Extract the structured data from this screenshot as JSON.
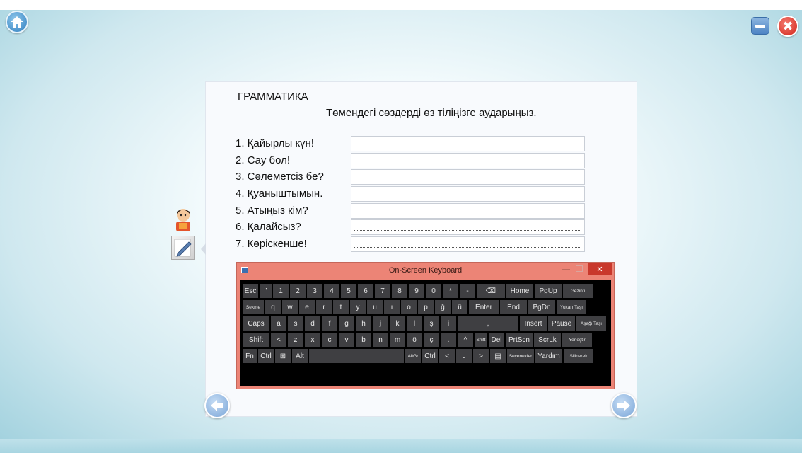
{
  "content": {
    "heading": "ГРАММАТИКА",
    "instruction": "Төмендегі сөздерді өз тіліңізге аударыңыз.",
    "items": [
      {
        "label": "1. Қайырлы күн!",
        "value": ""
      },
      {
        "label": "2. Сау бол!",
        "value": ""
      },
      {
        "label": "3. Сәлеметсіз бе?",
        "value": ""
      },
      {
        "label": "4. Қуаныштымын.",
        "value": ""
      },
      {
        "label": "5. Атыңыз кім?",
        "value": ""
      },
      {
        "label": "6. Қалайсыз?",
        "value": ""
      },
      {
        "label": "7. Көріскенше!",
        "value": ""
      }
    ]
  },
  "window_controls": {
    "close_glyph": "✖"
  },
  "icons": {
    "home": "home-icon",
    "minimize": "minimize-icon",
    "close": "close-icon",
    "prev": "arrow-left-icon",
    "next": "arrow-right-icon",
    "character": "character-icon",
    "edit": "pencil-icon"
  },
  "keyboard": {
    "title": "On-Screen Keyboard",
    "min_glyph": "—",
    "close_glyph": "✕",
    "rows": [
      [
        "Esc",
        "\"",
        "1",
        "2",
        "3",
        "4",
        "5",
        "6",
        "7",
        "8",
        "9",
        "0",
        "*",
        "-",
        "⌫",
        "Home",
        "PgUp",
        "Gezinti"
      ],
      [
        "Sekme",
        "q",
        "w",
        "e",
        "r",
        "t",
        "y",
        "u",
        "ı",
        "o",
        "p",
        "ğ",
        "ü",
        "Enter",
        "End",
        "PgDn",
        "Yukarı Taşı"
      ],
      [
        "Caps",
        "a",
        "s",
        "d",
        "f",
        "g",
        "h",
        "j",
        "k",
        "l",
        "ş",
        "i",
        ",",
        "Insert",
        "Pause",
        "Aşağı Taşı"
      ],
      [
        "Shift",
        "<",
        "z",
        "x",
        "c",
        "v",
        "b",
        "n",
        "m",
        "ö",
        "ç",
        ".",
        "^",
        "Shift",
        "Del",
        "PrtScn",
        "ScrLk",
        "Yerleştir"
      ],
      [
        "Fn",
        "Ctrl",
        "⊞",
        "Alt",
        "",
        "AltGr",
        "Ctrl",
        "<",
        "⌄",
        ">",
        "▤",
        "Seçenekler",
        "Yardım",
        "Silinerek"
      ]
    ]
  },
  "colors": {
    "accent": "#2f7fc1",
    "close": "#d2241a",
    "keyboard_frame": "#ec8476",
    "key": "#3f3f42"
  }
}
